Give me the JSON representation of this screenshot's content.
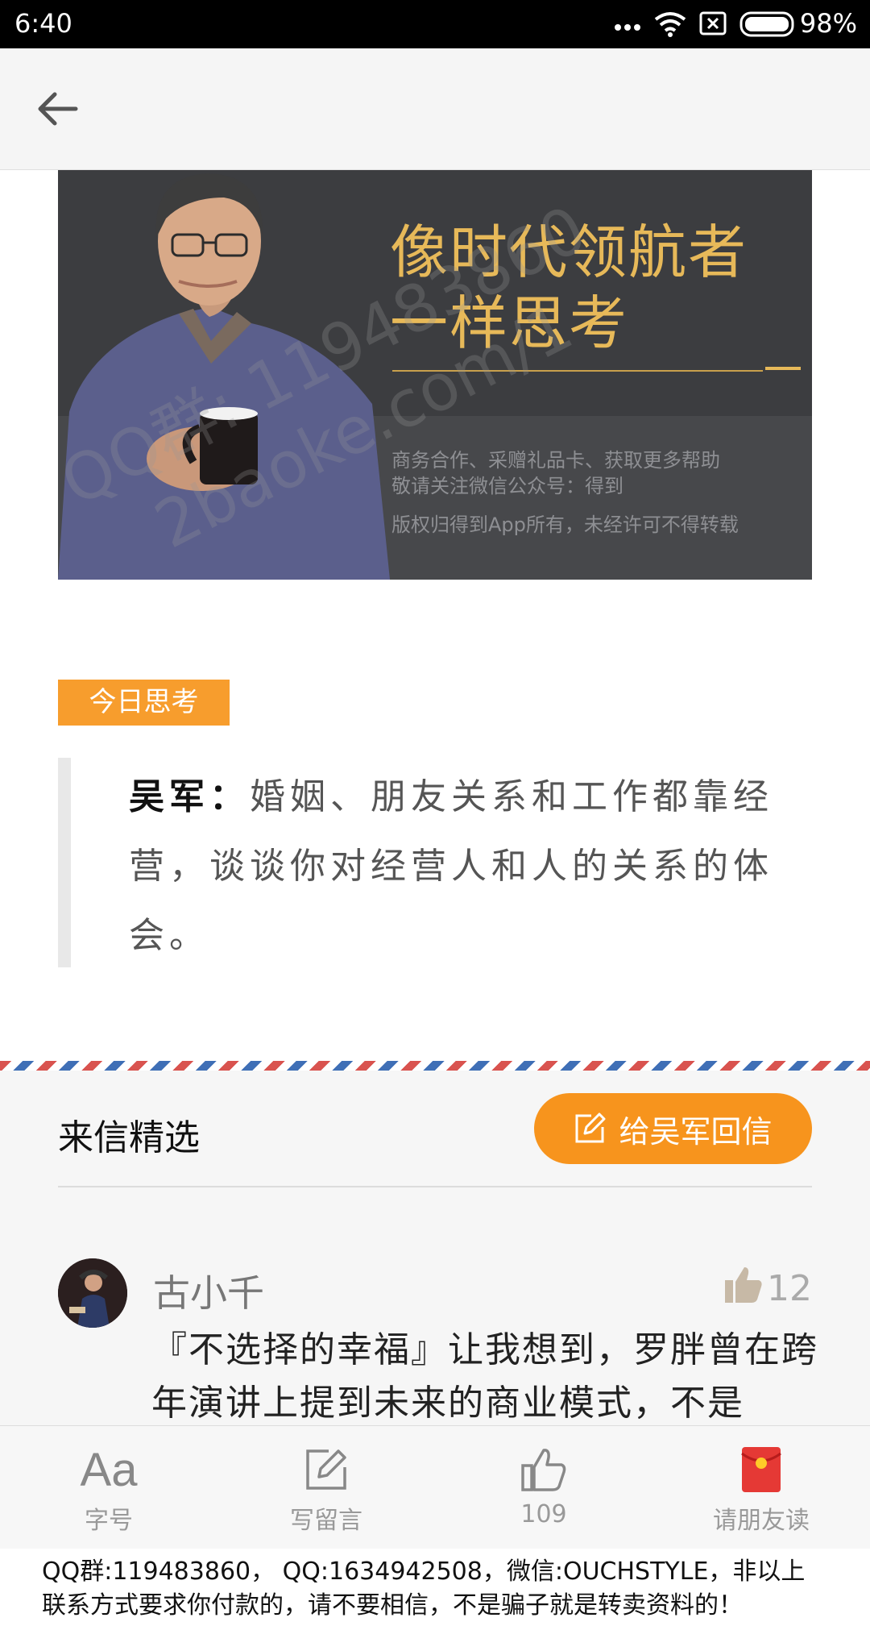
{
  "status_bar": {
    "time": "6:40",
    "battery": "98%"
  },
  "banner": {
    "title_line1": "像时代领航者",
    "title_line2": "一样思考",
    "info_line1": "商务合作、采赠礼品卡、获取更多帮助",
    "info_line2": "敬请关注微信公众号：得到",
    "info_line3": "版权归得到App所有，未经许可不得转载"
  },
  "today_tag": "今日思考",
  "quote": {
    "author": "吴军：",
    "text": "婚姻、朋友关系和工作都靠经营，谈谈你对经营人和人的关系的体会。"
  },
  "letters": {
    "title": "来信精选",
    "reply_button": "给吴军回信",
    "comment": {
      "name": "古小千",
      "likes": "12",
      "body": "『不选择的幸福』让我想到，罗胖曾在跨年演讲上提到未来的商业模式，不是"
    }
  },
  "toolbar": {
    "font_label": "字号",
    "write_label": "写留言",
    "like_count": "109",
    "share_label": "请朋友读"
  },
  "watermark": {
    "line1": "QQ群: 119483860",
    "line2": "2baoke.com/1"
  },
  "footer": {
    "line1": "QQ群:119483860， QQ:1634942508，微信:OUCHSTYLE，非以上",
    "line2": "联系方式要求你付款的，请不要相信，不是骗子就是转卖资料的！"
  },
  "colors": {
    "accent": "#f7941d",
    "tag": "#f79d2d",
    "banner_bg": "#3c3d40",
    "banner_title": "#e7b959"
  }
}
